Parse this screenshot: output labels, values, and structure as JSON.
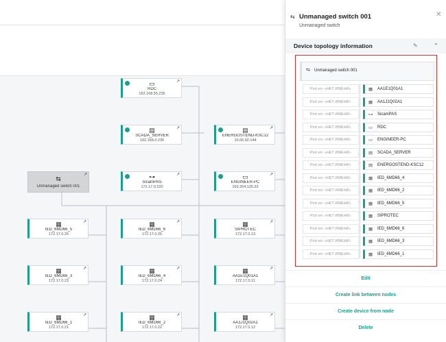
{
  "colors": {
    "accent": "#1a9f8b",
    "highlight_border": "#d42b2b"
  },
  "graph": {
    "nodes": [
      {
        "id": "rdc",
        "label": "RDC",
        "ip": "192.168.55.235",
        "icon": "monitor-icon",
        "check": true
      },
      {
        "id": "scada",
        "label": "SCADA_SERVER",
        "ip": "192.168.0.235",
        "icon": "server-icon",
        "check": true
      },
      {
        "id": "energo",
        "label": "ENERGOSTEND-KSC12",
        "ip": "10.65.92.144",
        "icon": "server-icon",
        "check": true
      },
      {
        "id": "sicampas",
        "label": "SicamPAS",
        "ip": "172.17.0.220",
        "icon": "plug-icon",
        "check": true
      },
      {
        "id": "engpc",
        "label": "ENGINEER-PC",
        "ip": "169.254.125.93",
        "icon": "monitor-icon",
        "check": true
      },
      {
        "id": "switch",
        "label": "Unmanaged switch 001",
        "ip": "",
        "icon": "switch-icon",
        "check": false
      },
      {
        "id": "ied5",
        "label": "IED_6MD66_5",
        "ip": "172.17.0.25",
        "icon": "ied-icon",
        "check": false
      },
      {
        "id": "ied6",
        "label": "IED_6MD66_6",
        "ip": "172.17.0.26",
        "icon": "ied-icon",
        "check": false
      },
      {
        "id": "siprotec",
        "label": "SIPROTEC",
        "ip": "172.17.0.13",
        "icon": "ied-icon",
        "check": false
      },
      {
        "id": "ied3",
        "label": "IED_6MD66_3",
        "ip": "172.17.0.23",
        "icon": "ied-icon",
        "check": false
      },
      {
        "id": "ied4",
        "label": "IED_6MD66_4",
        "ip": "172.17.0.24",
        "icon": "ied-icon",
        "check": false
      },
      {
        "id": "aa1e",
        "label": "AA1E1Q01A1",
        "ip": "172.17.0.11",
        "icon": "ied-icon",
        "check": false
      },
      {
        "id": "ied1",
        "label": "IED_6MD66_1",
        "ip": "172.17.0.21",
        "icon": "ied-icon",
        "check": false
      },
      {
        "id": "ied2",
        "label": "IED_6MD66_2",
        "ip": "172.17.0.22",
        "icon": "ied-icon",
        "check": false
      },
      {
        "id": "aa1j",
        "label": "AA1J1Q02A1",
        "ip": "172.17.0.12",
        "icon": "ied-icon",
        "check": false
      }
    ]
  },
  "panel": {
    "title": "Unmanaged switch 001",
    "subtitle": "Unmanaged switch",
    "close_icon": "close-icon",
    "section_title": "Device topology information",
    "switch_label": "Unmanaged switch 001",
    "port_label": "Port   en: «НЕТ ИМЕНИ»",
    "ports": [
      {
        "device": "AA1E1Q01A1",
        "icon": "ied-icon"
      },
      {
        "device": "AA1J1Q02A1",
        "icon": "ied-icon"
      },
      {
        "device": "SicamPAS",
        "icon": "plug-icon"
      },
      {
        "device": "RDC",
        "icon": "monitor-icon"
      },
      {
        "device": "ENGINEER-PC",
        "icon": "monitor-icon"
      },
      {
        "device": "SCADA_SERVER",
        "icon": "server-icon"
      },
      {
        "device": "ENERGOSTEND-KSC12",
        "icon": "server-icon"
      },
      {
        "device": "IED_6MD66_4",
        "icon": "ied-icon"
      },
      {
        "device": "IED_6MD66_2",
        "icon": "ied-icon"
      },
      {
        "device": "IED_6MD66_5",
        "icon": "ied-icon"
      },
      {
        "device": "SIPROTEC",
        "icon": "ied-icon"
      },
      {
        "device": "IED_6MD66_6",
        "icon": "ied-icon"
      },
      {
        "device": "IED_6MD66_3",
        "icon": "ied-icon"
      },
      {
        "device": "IED_6MD66_1",
        "icon": "ied-icon"
      }
    ],
    "actions": [
      "Edit",
      "Create link between nodes",
      "Create device from node",
      "Delete"
    ]
  }
}
